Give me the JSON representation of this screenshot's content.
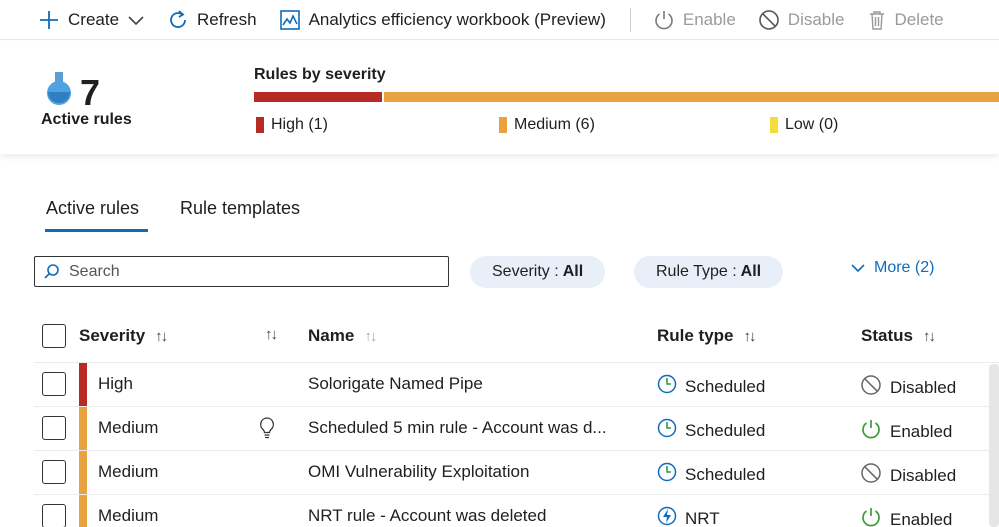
{
  "toolbar": {
    "create": "Create",
    "refresh": "Refresh",
    "workbook": "Analytics efficiency workbook (Preview)",
    "enable": "Enable",
    "disable": "Disable",
    "delete": "Delete"
  },
  "summary": {
    "active_count": "7",
    "active_label": "Active rules",
    "severity_title": "Rules by severity",
    "severity": [
      {
        "label": "High (1)",
        "count": 1,
        "color": "#b72b25"
      },
      {
        "label": "Medium (6)",
        "count": 6,
        "color": "#e8a340"
      },
      {
        "label": "Low (0)",
        "count": 0,
        "color": "#f5dc3c"
      }
    ]
  },
  "tabs": [
    "Active rules",
    "Rule templates"
  ],
  "filters": {
    "search_placeholder": "Search",
    "severity_label": "Severity :",
    "severity_value": "All",
    "ruletype_label": "Rule Type :",
    "ruletype_value": "All",
    "more": "More (2)"
  },
  "table": {
    "columns": {
      "severity": "Severity",
      "name": "Name",
      "rule_type": "Rule type",
      "status": "Status"
    },
    "rows": [
      {
        "severity": "High",
        "color": "#b72b25",
        "name": "Solorigate Named Pipe",
        "hint": false,
        "rule_type": "Scheduled",
        "type_icon": "clock-icon",
        "status": "Disabled",
        "status_icon": "disabled-icon"
      },
      {
        "severity": "Medium",
        "color": "#e8a340",
        "name": "Scheduled 5 min rule - Account was d...",
        "hint": true,
        "rule_type": "Scheduled",
        "type_icon": "clock-icon",
        "status": "Enabled",
        "status_icon": "power-icon"
      },
      {
        "severity": "Medium",
        "color": "#e8a340",
        "name": "OMI Vulnerability Exploitation",
        "hint": false,
        "rule_type": "Scheduled",
        "type_icon": "clock-icon",
        "status": "Disabled",
        "status_icon": "disabled-icon"
      },
      {
        "severity": "Medium",
        "color": "#e8a340",
        "name": "NRT rule - Account was deleted",
        "hint": false,
        "rule_type": "NRT",
        "type_icon": "lightning-icon",
        "status": "Enabled",
        "status_icon": "power-icon"
      }
    ]
  }
}
